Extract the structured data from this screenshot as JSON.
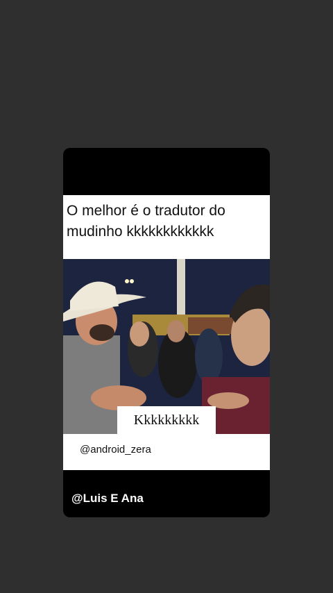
{
  "post": {
    "caption": "O melhor é o tradutor do mudinho kkkkkkkkkkkk",
    "subtitle": "Kkkkkkkkk",
    "watermark": "@android_zera",
    "credit": "@Luis E Ana"
  },
  "colors": {
    "background": "#2f2f2f",
    "card": "#000000",
    "panel": "#ffffff",
    "night_sky": "#1d2440"
  }
}
